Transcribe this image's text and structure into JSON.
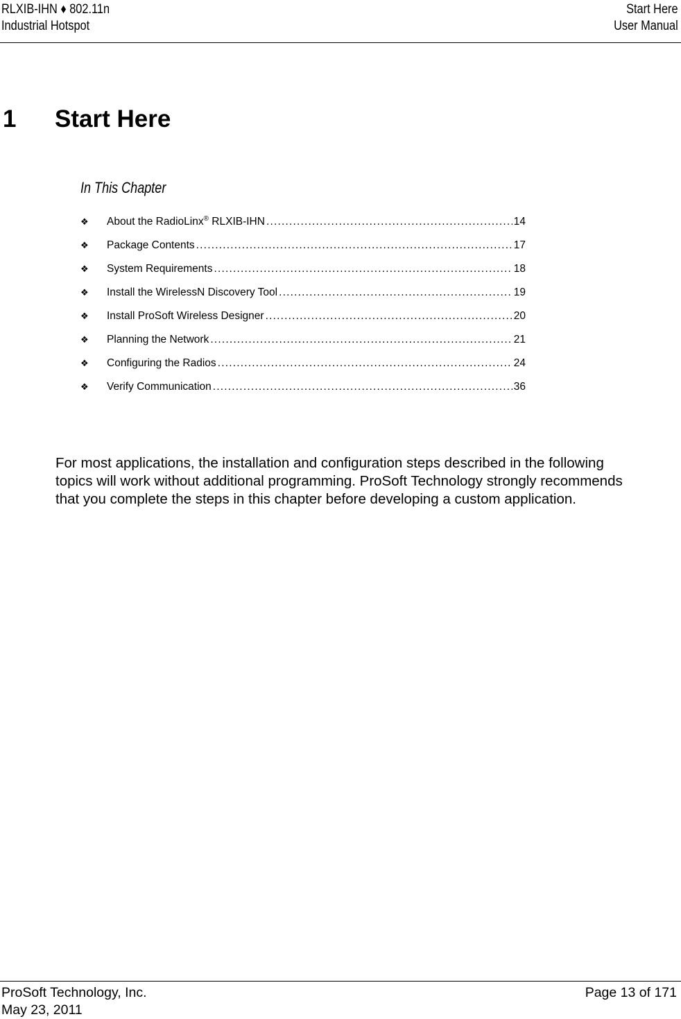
{
  "header": {
    "product": "RLXIB-IHN ♦ 802.11n",
    "subtitle": "Industrial Hotspot",
    "section": "Start Here",
    "doc_type": "User Manual"
  },
  "chapter": {
    "number": "1",
    "title": "Start Here"
  },
  "in_this_chapter": {
    "heading": "In This Chapter",
    "bullet_icon": "four-diamond-bullet",
    "items": [
      {
        "label": "About the RadioLinx",
        "sup": "®",
        "label_after": " RLXIB-IHN",
        "page": "14"
      },
      {
        "label": "Package Contents",
        "sup": "",
        "label_after": "",
        "page": "17"
      },
      {
        "label": "System Requirements",
        "sup": "",
        "label_after": "",
        "page": "18"
      },
      {
        "label": "Install the WirelessN Discovery Tool",
        "sup": "",
        "label_after": "",
        "page": "19"
      },
      {
        "label": "Install ProSoft Wireless Designer",
        "sup": "",
        "label_after": "",
        "page": "20"
      },
      {
        "label": "Planning the Network",
        "sup": "",
        "label_after": "",
        "page": "21"
      },
      {
        "label": "Configuring the Radios",
        "sup": "",
        "label_after": "",
        "page": "24"
      },
      {
        "label": "Verify Communication",
        "sup": "",
        "label_after": "",
        "page": "36"
      }
    ]
  },
  "body": {
    "paragraph": "For most applications, the installation and configuration steps described in the following topics will work without additional programming. ProSoft Technology strongly recommends that you complete the steps in this chapter before developing a custom application."
  },
  "footer": {
    "company": "ProSoft Technology, Inc.",
    "date": "May 23, 2011",
    "page_label": "Page 13 of 171"
  }
}
